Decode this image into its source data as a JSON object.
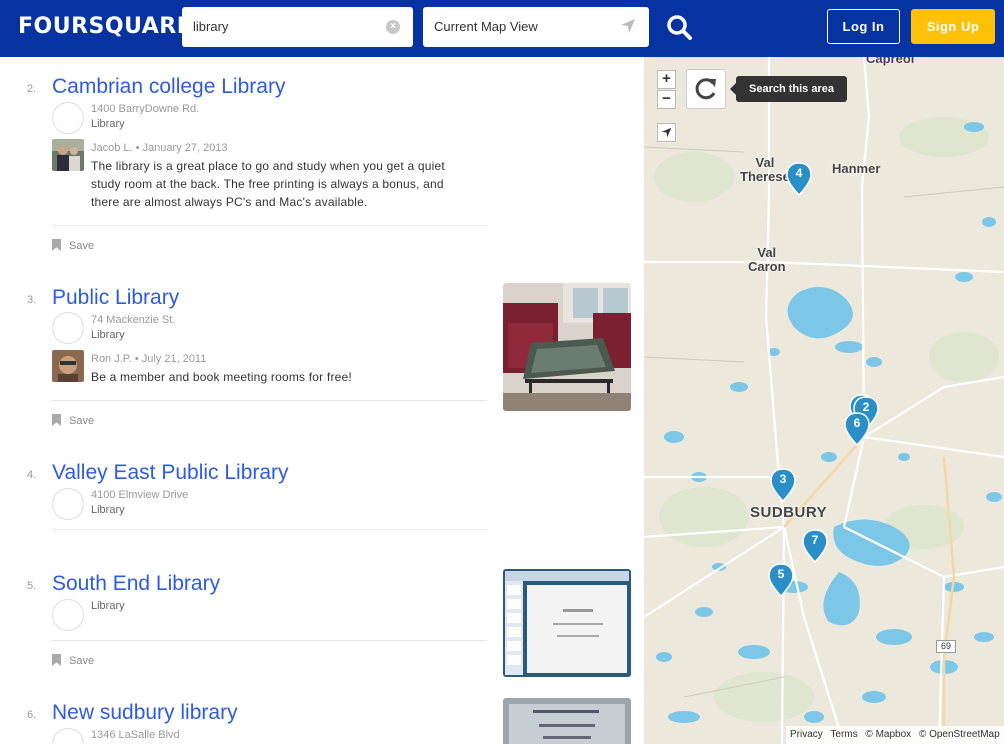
{
  "header": {
    "logo": "FOURSQUARE",
    "search_value": "library",
    "location_value": "Current Map View",
    "login_label": "Log In",
    "signup_label": "Sign Up"
  },
  "results": [
    {
      "rank": "2.",
      "title": "Cambrian college Library",
      "address": "1400 BarryDowne Rd.",
      "category": "Library",
      "tip_author_date": "Jacob L. • January 27, 2013",
      "tip_text": "The library is a great place to go and study when you get a quiet study room at the back. The free printing is always a bonus, and there are almost always PC's and Mac's available.",
      "save_label": "Save"
    },
    {
      "rank": "3.",
      "title": "Public Library",
      "address": "74 Mackenzie St.",
      "category": "Library",
      "tip_author_date": "Ron J.P. • July 21, 2011",
      "tip_text": "Be a member and book meeting rooms for free!",
      "save_label": "Save"
    },
    {
      "rank": "4.",
      "title": "Valley East Public Library",
      "address": "4100 Elmview Drive",
      "category": "Library"
    },
    {
      "rank": "5.",
      "title": "South End Library",
      "category": "Library",
      "save_label": "Save"
    },
    {
      "rank": "6.",
      "title": "New sudbury library",
      "address": "1346 LaSalle Blvd"
    }
  ],
  "map": {
    "search_area_label": "Search this area",
    "zoom_in": "+",
    "zoom_out": "−",
    "labels": {
      "capreol": "Capreol",
      "val_therese_1": "Val",
      "val_therese_2": "Therese",
      "hanmer": "Hanmer",
      "val_caron_1": "Val",
      "val_caron_2": "Caron",
      "sudbury": "SUDBURY"
    },
    "road_shield": "69",
    "pins": [
      "4",
      "2",
      "6",
      "3",
      "7",
      "5"
    ],
    "attribution": {
      "privacy": "Privacy",
      "terms": "Terms",
      "mapbox": "© Mapbox",
      "osm": "© OpenStreetMap"
    }
  },
  "colors": {
    "header_bg": "#0732a2",
    "signup_bg": "#ffc107",
    "link": "#2d5be3",
    "pin": "#2a8fc7",
    "water": "#7cc7e8"
  }
}
